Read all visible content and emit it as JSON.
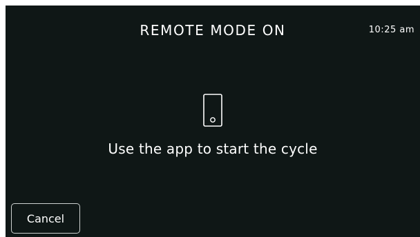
{
  "header": {
    "title": "REMOTE MODE ON",
    "time": "10:25 am"
  },
  "main": {
    "icon": "phone-icon",
    "message": "Use the app to start the cycle"
  },
  "footer": {
    "cancel_label": "Cancel"
  },
  "colors": {
    "background": "#0f1716",
    "text": "#ffffff",
    "button_border": "#cfd3d2"
  }
}
